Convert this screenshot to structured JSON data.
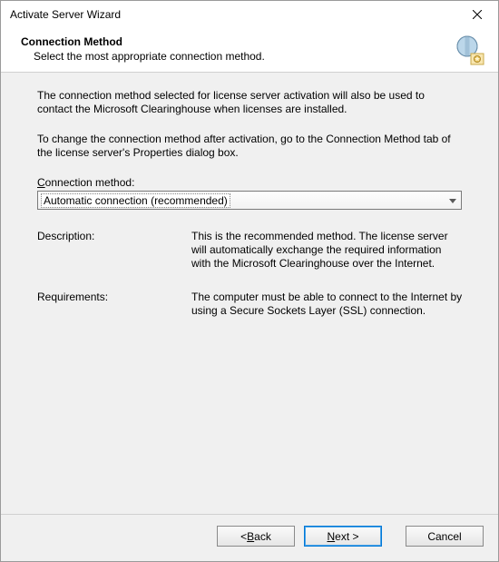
{
  "window": {
    "title": "Activate Server Wizard"
  },
  "header": {
    "title": "Connection Method",
    "subtitle": "Select the most appropriate connection method."
  },
  "body": {
    "para1": "The connection method selected for license server activation will also be used to contact the Microsoft Clearinghouse when licenses are installed.",
    "para2": "To change the connection method after activation, go to the Connection Method tab of the license server's Properties dialog box.",
    "combo_label_pre": "C",
    "combo_label_post": "onnection method:",
    "combo_value": "Automatic connection (recommended)",
    "desc_label": "Description:",
    "desc_value": "This is the recommended method. The license server will automatically exchange the required information with the Microsoft Clearinghouse over the Internet.",
    "req_label": "Requirements:",
    "req_value": "The computer must be able to connect to the Internet by using a Secure Sockets Layer (SSL) connection."
  },
  "footer": {
    "back_pre": "< ",
    "back_u": "B",
    "back_post": "ack",
    "next_u": "N",
    "next_post": "ext >",
    "cancel": "Cancel"
  }
}
